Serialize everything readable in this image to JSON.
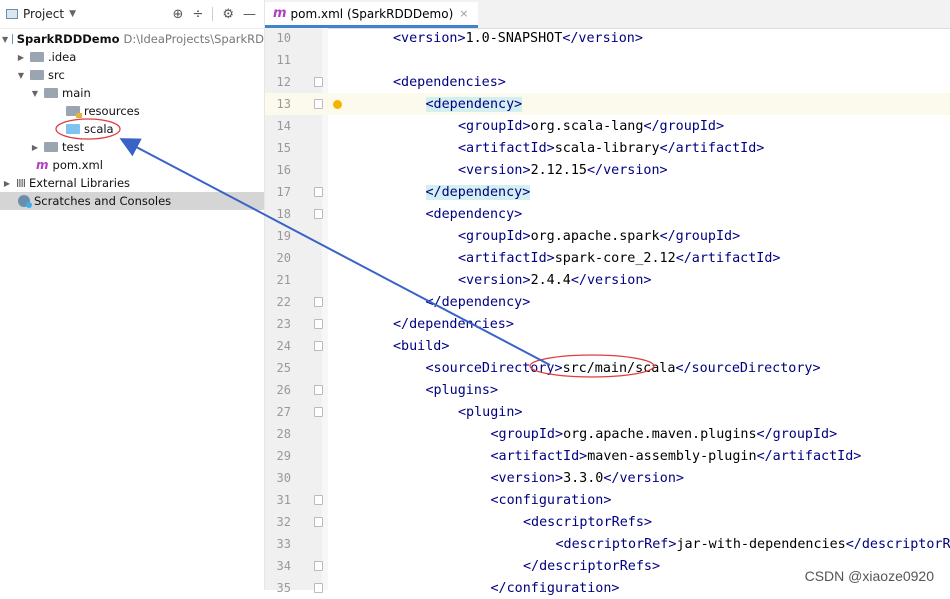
{
  "project_panel": {
    "title": "Project",
    "icons": [
      "project-icon",
      "dropdown-caret-icon",
      "crosshair-icon",
      "collapse-icon",
      "gear-icon",
      "minimize-icon"
    ]
  },
  "tree": {
    "root": {
      "label": "SparkRDDDemo",
      "path": "D:\\IdeaProjects\\SparkRD"
    },
    "idea": ".idea",
    "src": "src",
    "main": "main",
    "resources": "resources",
    "scala": "scala",
    "test": "test",
    "pom": "pom.xml",
    "external": "External Libraries",
    "scratches": "Scratches and Consoles"
  },
  "editor_tab": {
    "label": "pom.xml (SparkRDDDemo)",
    "close": "×"
  },
  "code_lines": [
    {
      "n": "10",
      "indent": 2,
      "text": "<version>1.0-SNAPSHOT</version>"
    },
    {
      "n": "11",
      "indent": 0,
      "text": ""
    },
    {
      "n": "12",
      "indent": 2,
      "text": "<dependencies>"
    },
    {
      "n": "13",
      "indent": 3,
      "text": "<dependency>"
    },
    {
      "n": "14",
      "indent": 4,
      "text": "<groupId>org.scala-lang</groupId>"
    },
    {
      "n": "15",
      "indent": 4,
      "text": "<artifactId>scala-library</artifactId>"
    },
    {
      "n": "16",
      "indent": 4,
      "text": "<version>2.12.15</version>"
    },
    {
      "n": "17",
      "indent": 3,
      "text": "</dependency>"
    },
    {
      "n": "18",
      "indent": 3,
      "text": "<dependency>"
    },
    {
      "n": "19",
      "indent": 4,
      "text": "<groupId>org.apache.spark</groupId>"
    },
    {
      "n": "20",
      "indent": 4,
      "text": "<artifactId>spark-core_2.12</artifactId>"
    },
    {
      "n": "21",
      "indent": 4,
      "text": "<version>2.4.4</version>"
    },
    {
      "n": "22",
      "indent": 3,
      "text": "</dependency>"
    },
    {
      "n": "23",
      "indent": 2,
      "text": "</dependencies>"
    },
    {
      "n": "24",
      "indent": 2,
      "text": "<build>"
    },
    {
      "n": "25",
      "indent": 3,
      "text": "<sourceDirectory>src/main/scala</sourceDirectory>"
    },
    {
      "n": "26",
      "indent": 3,
      "text": "<plugins>"
    },
    {
      "n": "27",
      "indent": 4,
      "text": "<plugin>"
    },
    {
      "n": "28",
      "indent": 5,
      "text": "<groupId>org.apache.maven.plugins</groupId>"
    },
    {
      "n": "29",
      "indent": 5,
      "text": "<artifactId>maven-assembly-plugin</artifactId>"
    },
    {
      "n": "30",
      "indent": 5,
      "text": "<version>3.3.0</version>"
    },
    {
      "n": "31",
      "indent": 5,
      "text": "<configuration>"
    },
    {
      "n": "32",
      "indent": 6,
      "text": "<descriptorRefs>"
    },
    {
      "n": "33",
      "indent": 7,
      "text": "<descriptorRef>jar-with-dependencies</descriptorRef>"
    },
    {
      "n": "34",
      "indent": 6,
      "text": "</descriptorRefs>"
    },
    {
      "n": "35",
      "indent": 5,
      "text": "</configuration>"
    }
  ],
  "fold_markers": [
    "12",
    "13",
    "17",
    "18",
    "22",
    "23",
    "24",
    "26",
    "27",
    "31",
    "32",
    "34",
    "35"
  ],
  "current_line": "13",
  "highlighted_lines": [
    "13",
    "17"
  ],
  "watermark": "CSDN @xiaoze0920",
  "colors": {
    "tag": "#000080",
    "annotation": "#e03c3c",
    "arrow": "#3a63c8",
    "selection": "#d5d5d5",
    "tab_underline": "#4083c9"
  }
}
